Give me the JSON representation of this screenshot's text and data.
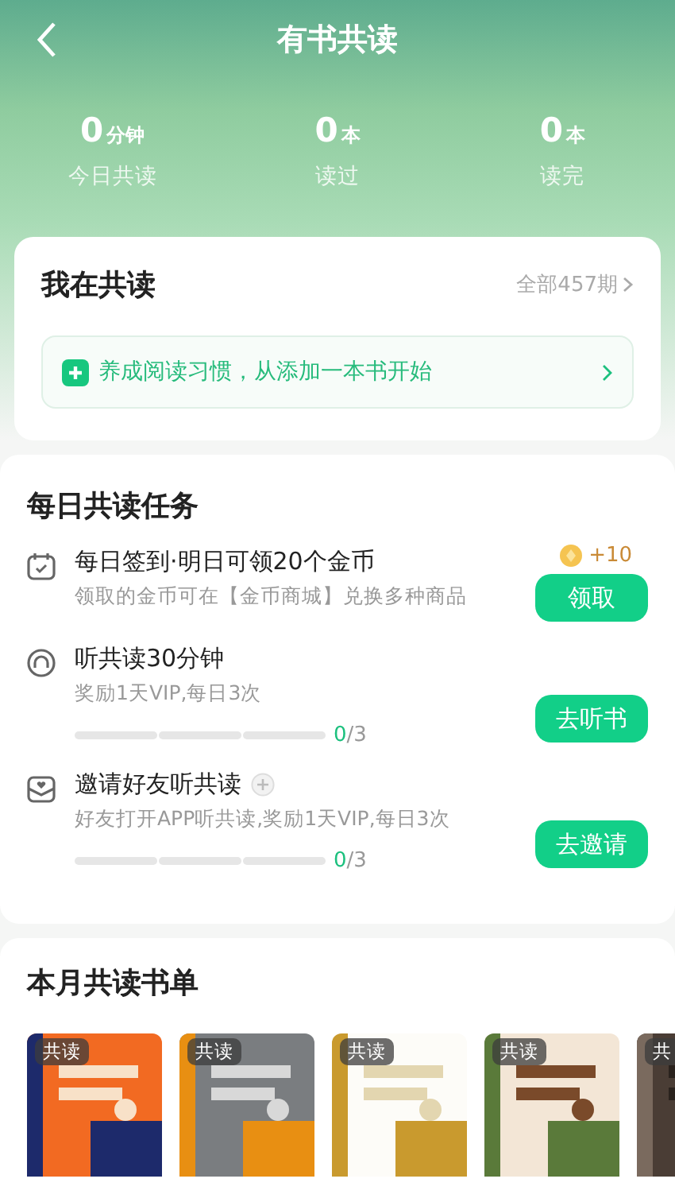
{
  "header": {
    "title": "有书共读"
  },
  "stats": [
    {
      "value": "0",
      "unit": "分钟",
      "label": "今日共读"
    },
    {
      "value": "0",
      "unit": "本",
      "label": "读过"
    },
    {
      "value": "0",
      "unit": "本",
      "label": "读完"
    }
  ],
  "my_reading": {
    "title": "我在共读",
    "link": "全部457期",
    "prompt": "养成阅读习惯，从添加一本书开始"
  },
  "daily_tasks": {
    "title": "每日共读任务",
    "tasks": [
      {
        "kind": "reward",
        "title": "每日签到·明日可领20个金币",
        "subtitle": "领取的金币可在【金币商城】兑换多种商品",
        "reward": "+10",
        "button": "领取"
      },
      {
        "kind": "progress",
        "title": "听共读30分钟",
        "subtitle": "奖励1天VIP,每日3次",
        "done": "0",
        "total": "/3",
        "button": "去听书"
      },
      {
        "kind": "progress",
        "title": "邀请好友听共读",
        "extra_icon": true,
        "subtitle": "好友打开APP听共读,奖励1天VIP,每日3次",
        "done": "0",
        "total": "/3",
        "button": "去邀请"
      }
    ]
  },
  "monthly_list": {
    "title": "本月共读书单",
    "books": [
      {
        "kind": "picture",
        "badge": "共读"
      },
      {
        "kind": "picture",
        "badge": "共读"
      },
      {
        "kind": "picture",
        "badge": "共读"
      },
      {
        "kind": "picture",
        "badge": "共读"
      },
      {
        "kind": "picture",
        "badge": "共"
      }
    ]
  }
}
